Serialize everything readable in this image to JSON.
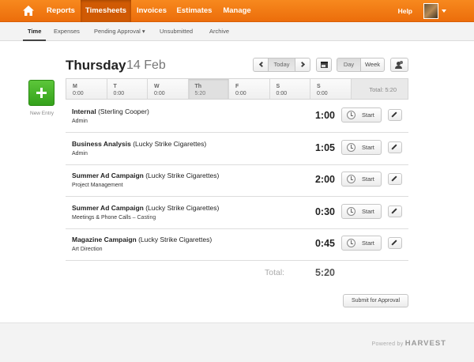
{
  "topnav": {
    "home_icon": "home-icon",
    "items": [
      {
        "label": "Reports"
      },
      {
        "label": "Timesheets",
        "active": true
      },
      {
        "label": "Invoices"
      },
      {
        "label": "Estimates"
      },
      {
        "label": "Manage"
      }
    ],
    "help": "Help",
    "accent": "#f07d16"
  },
  "subnav": {
    "items": [
      {
        "label": "Time",
        "active": true
      },
      {
        "label": "Expenses"
      },
      {
        "label": "Pending Approval ▾"
      },
      {
        "label": "Unsubmitted"
      },
      {
        "label": "Archive"
      }
    ]
  },
  "new_entry": {
    "label": "New Entry"
  },
  "date_header": {
    "day": "Thursday",
    "date": "14 Feb"
  },
  "controls": {
    "today": "Today",
    "day": "Day",
    "week": "Week"
  },
  "week": {
    "days": [
      {
        "letter": "M",
        "hours": "0:00"
      },
      {
        "letter": "T",
        "hours": "0:00"
      },
      {
        "letter": "W",
        "hours": "0:00"
      },
      {
        "letter": "Th",
        "hours": "5:20",
        "active": true
      },
      {
        "letter": "F",
        "hours": "0:00"
      },
      {
        "letter": "S",
        "hours": "0:00"
      },
      {
        "letter": "S",
        "hours": "0:00"
      }
    ],
    "total": "Total:  5:20"
  },
  "entries": [
    {
      "project": "Internal",
      "client": "(Sterling Cooper)",
      "task": "Admin",
      "note": "",
      "hours": "1:00"
    },
    {
      "project": "Business Analysis",
      "client": "(Lucky Strike Cigarettes)",
      "task": "Admin",
      "note": "",
      "hours": "1:05"
    },
    {
      "project": "Summer Ad Campaign",
      "client": "(Lucky Strike Cigarettes)",
      "task": "Project Management",
      "note": "",
      "hours": "2:00"
    },
    {
      "project": "Summer Ad Campaign",
      "client": "(Lucky Strike Cigarettes)",
      "task": "Meetings & Phone Calls",
      "note": " –  Casting",
      "hours": "0:30"
    },
    {
      "project": "Magazine Campaign",
      "client": "(Lucky Strike Cigarettes)",
      "task": "Art Direction",
      "note": "",
      "hours": "0:45"
    }
  ],
  "start_label": "Start",
  "totals": {
    "label": "Total:",
    "value": "5:20"
  },
  "submit_label": "Submit for Approval",
  "footer": {
    "powered_by": "Powered by",
    "brand": "HARVEST"
  }
}
